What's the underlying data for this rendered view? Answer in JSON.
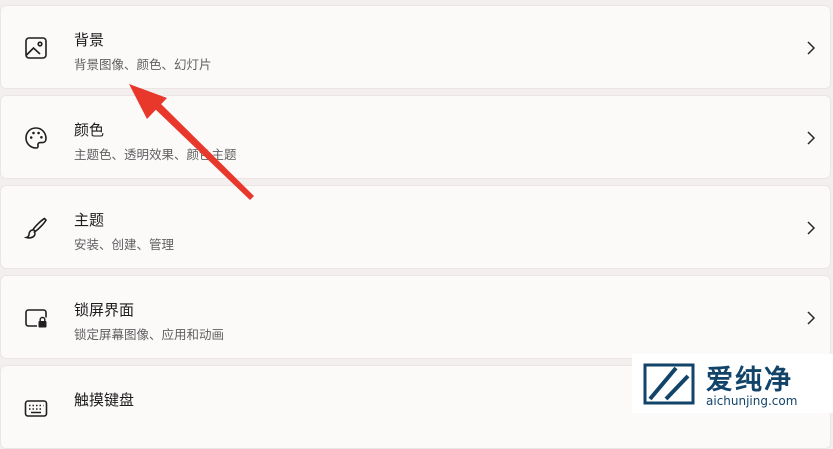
{
  "settings": {
    "items": [
      {
        "title": "背景",
        "subtitle": "背景图像、颜色、幻灯片",
        "icon": "image-icon"
      },
      {
        "title": "颜色",
        "subtitle": "主题色、透明效果、颜色主题",
        "icon": "palette-icon"
      },
      {
        "title": "主题",
        "subtitle": "安装、创建、管理",
        "icon": "brush-icon"
      },
      {
        "title": "锁屏界面",
        "subtitle": "锁定屏幕图像、应用和动画",
        "icon": "lock-screen-icon"
      },
      {
        "title": "触摸键盘",
        "subtitle": "",
        "icon": "keyboard-icon"
      }
    ]
  },
  "annotation": {
    "arrow_color": "#e8382b"
  },
  "watermark": {
    "brand": "爱纯净",
    "domain": "aichunjing.com",
    "color": "#12446a"
  }
}
